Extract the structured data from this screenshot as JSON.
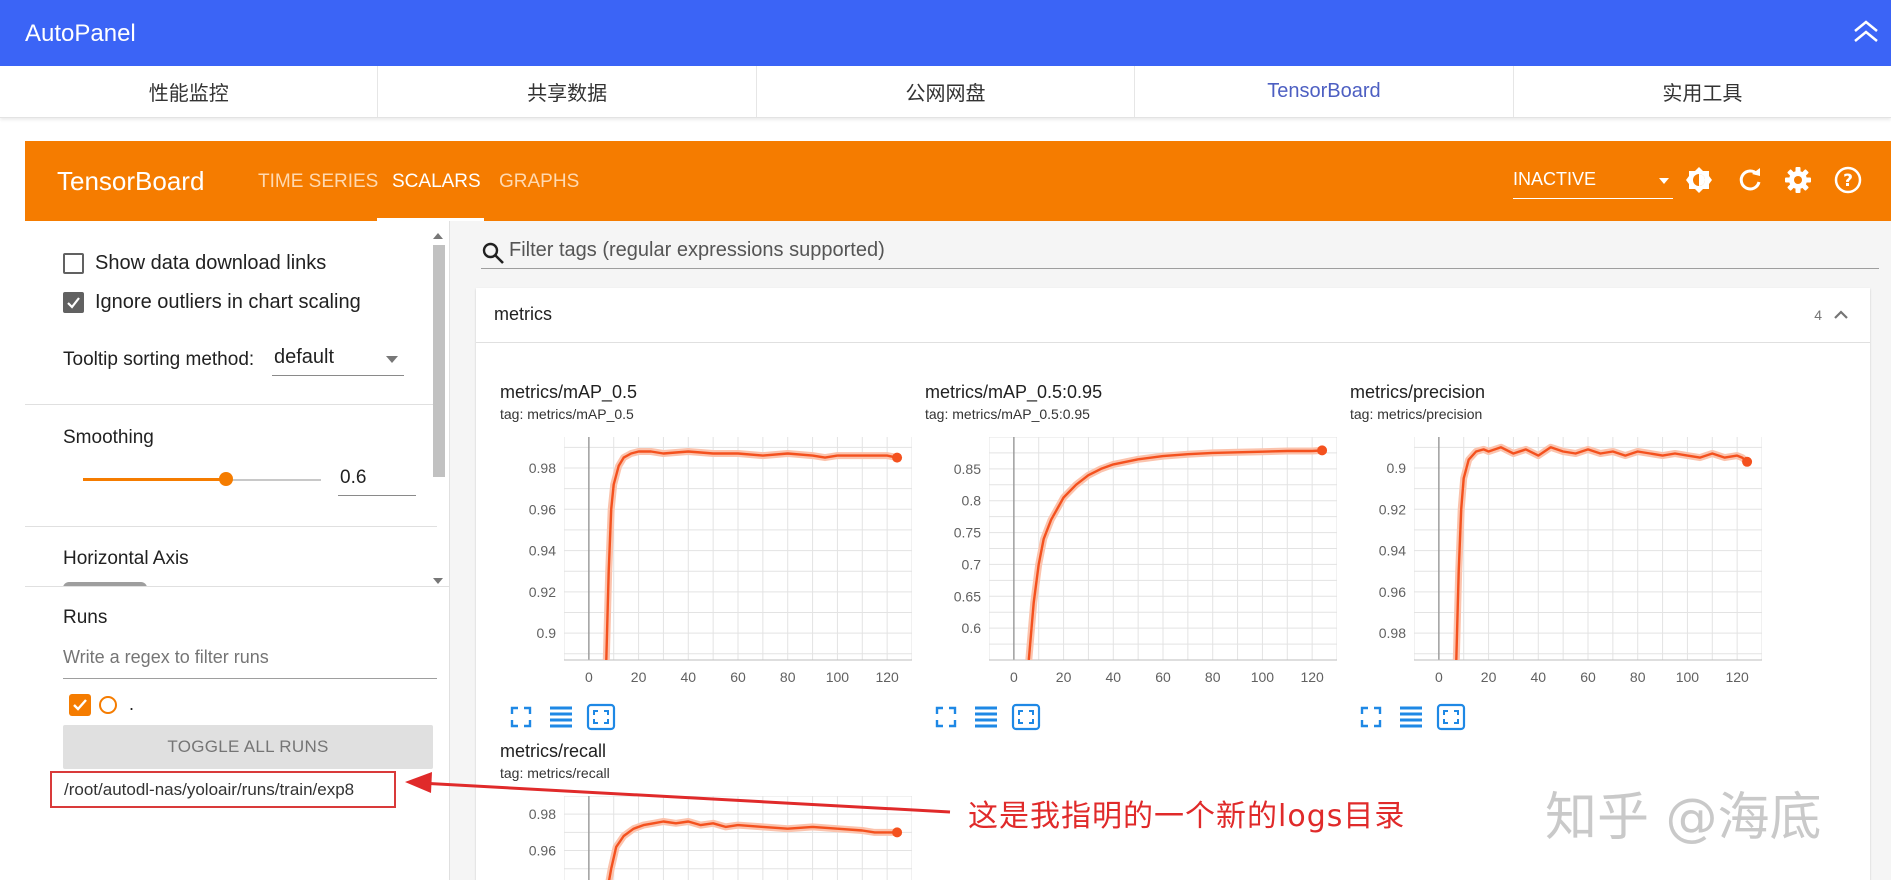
{
  "autopanel": {
    "title": "AutoPanel",
    "tabs": [
      {
        "label": "性能监控",
        "active": false
      },
      {
        "label": "共享数据",
        "active": false
      },
      {
        "label": "公网网盘",
        "active": false
      },
      {
        "label": "TensorBoard",
        "active": true
      },
      {
        "label": "实用工具",
        "active": false
      }
    ],
    "accent_color": "#3b64f6"
  },
  "tensorboard": {
    "logo": "TensorBoard",
    "nav": [
      {
        "label": "TIME SERIES",
        "active": false
      },
      {
        "label": "SCALARS",
        "active": true
      },
      {
        "label": "GRAPHS",
        "active": false
      }
    ],
    "status_select": "INACTIVE",
    "toolbar_icons": [
      "brightness-icon",
      "refresh-icon",
      "settings-icon",
      "help-icon"
    ],
    "accent_color": "#f57c00"
  },
  "sidebar": {
    "show_download_links": {
      "label": "Show data download links",
      "checked": false
    },
    "ignore_outliers": {
      "label": "Ignore outliers in chart scaling",
      "checked": true
    },
    "tooltip_sorting": {
      "label": "Tooltip sorting method:",
      "value": "default"
    },
    "smoothing": {
      "label": "Smoothing",
      "value": "0.6",
      "fraction": 0.6
    },
    "horizontal_axis": {
      "label": "Horizontal Axis"
    },
    "runs": {
      "title": "Runs",
      "filter_placeholder": "Write a regex to filter runs",
      "items": [
        {
          "name": ".",
          "checked": true
        }
      ],
      "toggle_label": "TOGGLE ALL RUNS",
      "log_path": "/root/autodl-nas/yoloair/runs/train/exp8"
    }
  },
  "main": {
    "filter_placeholder": "Filter tags (regular expressions supported)",
    "card": {
      "title": "metrics",
      "count": "4"
    }
  },
  "chart_data": [
    {
      "type": "line",
      "title": "metrics/mAP_0.5",
      "subtitle": "tag: metrics/mAP_0.5",
      "xlim": [
        -10,
        130
      ],
      "ylim": [
        0.887,
        0.995
      ],
      "xticks": [
        0,
        20,
        40,
        60,
        80,
        100,
        120
      ],
      "yticks": [
        0.9,
        0.92,
        0.94,
        0.96,
        0.98
      ],
      "ytick_labels": [
        "0.9",
        "0.92",
        "0.94",
        "0.96",
        "0.98"
      ],
      "grid": true,
      "series": [
        {
          "color": "#f4511e",
          "x": [
            7,
            8,
            9,
            10,
            12,
            14,
            17,
            20,
            25,
            30,
            40,
            50,
            60,
            70,
            80,
            90,
            95,
            100,
            110,
            120,
            124
          ],
          "y": [
            0.887,
            0.93,
            0.96,
            0.972,
            0.981,
            0.985,
            0.987,
            0.988,
            0.988,
            0.987,
            0.988,
            0.987,
            0.987,
            0.986,
            0.987,
            0.986,
            0.985,
            0.986,
            0.986,
            0.986,
            0.985
          ]
        }
      ]
    },
    {
      "type": "line",
      "title": "metrics/mAP_0.5:0.95",
      "subtitle": "tag: metrics/mAP_0.5:0.95",
      "xlim": [
        -10,
        130
      ],
      "ylim": [
        0.55,
        0.9
      ],
      "xticks": [
        0,
        20,
        40,
        60,
        80,
        100,
        120
      ],
      "yticks": [
        0.6,
        0.65,
        0.7,
        0.75,
        0.8,
        0.85
      ],
      "ytick_labels": [
        "0.6",
        "0.65",
        "0.7",
        "0.75",
        "0.8",
        "0.85"
      ],
      "grid": true,
      "series": [
        {
          "color": "#f4511e",
          "x": [
            6,
            8,
            10,
            12,
            15,
            20,
            25,
            30,
            35,
            40,
            50,
            60,
            70,
            80,
            90,
            100,
            110,
            120,
            124
          ],
          "y": [
            0.55,
            0.64,
            0.7,
            0.74,
            0.77,
            0.805,
            0.825,
            0.84,
            0.85,
            0.857,
            0.865,
            0.87,
            0.873,
            0.875,
            0.876,
            0.877,
            0.878,
            0.878,
            0.879
          ]
        }
      ]
    },
    {
      "type": "line",
      "title": "metrics/precision",
      "subtitle": "tag: metrics/precision",
      "xlim": [
        -10,
        130
      ],
      "ylim": [
        0.887,
        0.995
      ],
      "xticks": [
        0,
        20,
        40,
        60,
        80,
        100,
        120
      ],
      "yticks": [
        0.9,
        0.92,
        0.94,
        0.96,
        0.98
      ],
      "ytick_labels": [
        "0.98",
        "0.96",
        "0.94",
        "0.92",
        "0.9"
      ],
      "grid": true,
      "series": [
        {
          "color": "#f4511e",
          "x": [
            7,
            8,
            9,
            10,
            12,
            15,
            18,
            20,
            25,
            30,
            35,
            40,
            45,
            50,
            55,
            60,
            65,
            70,
            75,
            80,
            85,
            90,
            95,
            100,
            105,
            110,
            115,
            120,
            122,
            124
          ],
          "y": [
            0.887,
            0.93,
            0.96,
            0.975,
            0.984,
            0.988,
            0.989,
            0.988,
            0.99,
            0.987,
            0.989,
            0.986,
            0.99,
            0.988,
            0.987,
            0.989,
            0.987,
            0.988,
            0.986,
            0.988,
            0.987,
            0.986,
            0.987,
            0.986,
            0.985,
            0.987,
            0.985,
            0.986,
            0.985,
            0.983
          ]
        }
      ]
    },
    {
      "type": "line",
      "title": "metrics/recall",
      "subtitle": "tag: metrics/recall",
      "xlim": [
        -10,
        130
      ],
      "ylim": [
        0.935,
        0.99
      ],
      "xticks": [],
      "yticks": [
        0.94,
        0.96,
        0.98
      ],
      "ytick_labels": [
        "0.94",
        "0.96",
        "0.98"
      ],
      "grid": true,
      "series": [
        {
          "color": "#f4511e",
          "x": [
            7,
            9,
            11,
            14,
            18,
            22,
            26,
            30,
            35,
            40,
            45,
            50,
            55,
            60,
            70,
            80,
            90,
            100,
            110,
            115,
            120,
            124
          ],
          "y": [
            0.935,
            0.95,
            0.962,
            0.968,
            0.972,
            0.974,
            0.975,
            0.976,
            0.975,
            0.976,
            0.974,
            0.975,
            0.973,
            0.974,
            0.973,
            0.972,
            0.973,
            0.972,
            0.971,
            0.97,
            0.97,
            0.97
          ]
        }
      ]
    }
  ],
  "annotation": {
    "text": "这是我指明的一个新的logs目录",
    "color": "#e02a2a"
  },
  "watermark": "知乎 @海底"
}
